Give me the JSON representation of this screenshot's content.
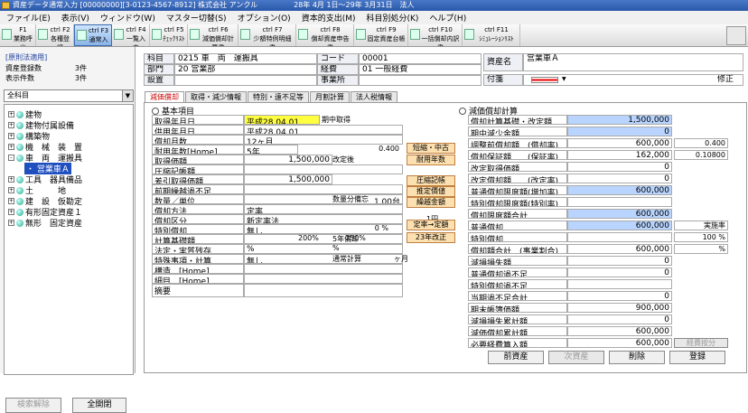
{
  "window": {
    "title": "資産データ通常入力 [00000000][3-0123-4567-8912] 株式会社 アンクル　　　　　28年 4月 1日～29年 3月31日　法人"
  },
  "menu": [
    "ファイル(E)",
    "表示(V)",
    "ウィンドウ(W)",
    "マスター切替(S)",
    "オプション(O)",
    "資本的支出(M)",
    "科目別処分(K)",
    "ヘルプ(H)"
  ],
  "toolbar": [
    {
      "key": "F1",
      "label": "業務呼出"
    },
    {
      "key": "ctrl F2",
      "label": "各種登録"
    },
    {
      "key": "ctrl F3",
      "label": "通常入力"
    },
    {
      "key": "ctrl F4",
      "label": "一覧入力"
    },
    {
      "key": "ctrl F5",
      "label": "ﾁｪｯｸﾘｽﾄ"
    },
    {
      "key": "ctrl F6",
      "label": "減価償却計算書"
    },
    {
      "key": "ctrl F7",
      "label": "少額特例明細書"
    },
    {
      "key": "ctrl F8",
      "label": "償却資産申告書"
    },
    {
      "key": "ctrl F9",
      "label": "固定資産台帳"
    },
    {
      "key": "ctrl F10",
      "label": "一括償却内訳書"
    },
    {
      "key": "ctrl F11",
      "label": "ｼﾐｭﾚｰｼｮﾝﾘｽﾄ"
    }
  ],
  "left": {
    "mode": "[原則法適用]",
    "stats": [
      {
        "label": "資産登録数",
        "value": "3件"
      },
      {
        "label": "表示件数",
        "value": "3件"
      }
    ],
    "filter": "全科目",
    "tree": [
      {
        "label": "建物",
        "exp": "+"
      },
      {
        "label": "建物付属設備",
        "exp": "+"
      },
      {
        "label": "構築物",
        "exp": "+"
      },
      {
        "label": "機　械　装　置",
        "exp": "+"
      },
      {
        "label": "車　両　運搬具",
        "exp": "-"
      },
      {
        "label": "・ 営業車Ａ",
        "exp": ""
      },
      {
        "label": "工具　器具備品",
        "exp": "+"
      },
      {
        "label": "土　　　地",
        "exp": "+"
      },
      {
        "label": "建　設　仮勘定",
        "exp": "+"
      },
      {
        "label": "有形固定資産１",
        "exp": "+"
      },
      {
        "label": "無形　固定資産",
        "exp": "+"
      }
    ],
    "btn_search_clear": "検索解除",
    "btn_expand_all": "全開閉"
  },
  "header": {
    "kamoku_lbl": "科目",
    "kamoku_val": "0215 車　両　運搬具",
    "code_lbl": "コード",
    "code_val": "00001",
    "shisanmei_lbl": "資産名",
    "shisanmei_val": "営業車Ａ",
    "bumon_lbl": "部門",
    "bumon_val": "20 営業部",
    "keihi_lbl": "経費",
    "keihi_val": "01 一般経費",
    "basho_lbl": "設置",
    "jigyosho_lbl": "事業所",
    "fusen_lbl": "付箋",
    "fusen_val": "修正"
  },
  "tabs": [
    "減価償却",
    "取得・減少情報",
    "特別・遠不足等",
    "月割計算",
    "法人税情報"
  ],
  "basic": {
    "title": "基本項目",
    "rows": [
      {
        "label": "取得年月日",
        "value": "平成28.04.01",
        "extra": "期中取得"
      },
      {
        "label": "供用年月日",
        "value": "平成28.04.01",
        "extra": ""
      },
      {
        "label": "償却月数",
        "value": "12ヶ月",
        "extra": ""
      },
      {
        "label": "耐用年数[Home]",
        "value": "5年",
        "extra": "0.400"
      },
      {
        "label": "取得価額",
        "value": "1,500,000",
        "extra": "改定後"
      },
      {
        "label": "圧縮記帳額",
        "value": "",
        "extra": ""
      },
      {
        "label": "差引取得価額",
        "value": "1,500,000",
        "extra": ""
      },
      {
        "label": "前期繰越過不足",
        "value": "",
        "extra": ""
      },
      {
        "label": "数量／単位",
        "value": "1.00台",
        "extra": "数量分備忘"
      },
      {
        "label": "償却方法",
        "value": "定率",
        "extra": ""
      },
      {
        "label": "償却区分",
        "value": "新定率法",
        "extra": ""
      },
      {
        "label": "特別償却",
        "value": "無し",
        "extra": "0 %"
      },
      {
        "label": "計算基礎額",
        "value": "",
        "extra": "5年償却"
      },
      {
        "label": "法定・実質残存",
        "value": "%",
        "extra": "%"
      },
      {
        "label": "特殊事項・計算",
        "value": "無し",
        "extra": "通常計算"
      },
      {
        "label": "構造　[Home]",
        "value": "",
        "extra": ""
      },
      {
        "label": "細目　[Home]",
        "value": "",
        "extra": ""
      },
      {
        "label": "摘要",
        "value": "",
        "extra": ""
      }
    ],
    "radio_200": "200%",
    "radio_250": "250%",
    "tsuki_unit": "ヶ月",
    "unit_yen": "1円",
    "buttons": [
      "短縮・中古",
      "耐用年数",
      "圧縮記帳",
      "推定價値",
      "繰越金額",
      "定率→定額",
      "23年改正"
    ]
  },
  "calc": {
    "title": "減価償却計算",
    "rows": [
      {
        "label": "償却計算基礎・改定額",
        "value": "1,500,000",
        "extra": "",
        "blue": true
      },
      {
        "label": "期中減少金額",
        "value": "0",
        "extra": "",
        "blue": true
      },
      {
        "label": "調整前償却額　(償却率)",
        "value": "600,000",
        "extra": "0.400",
        "blue": false
      },
      {
        "label": "償却保証額　　(保証率)",
        "value": "162,000",
        "extra": "0.10800",
        "blue": false
      },
      {
        "label": "改定取得価額",
        "value": "0",
        "extra": "",
        "blue": false
      },
      {
        "label": "改定償却額　　(改定率)",
        "value": "0",
        "extra": "",
        "blue": false
      },
      {
        "label": "普通償却限度額(増加率)",
        "value": "600,000",
        "extra": "",
        "blue": true
      },
      {
        "label": "特別償却限度額(特別率)",
        "value": "",
        "extra": "",
        "blue": false
      },
      {
        "label": "償却限度額合計",
        "value": "600,000",
        "extra": "",
        "blue": true
      },
      {
        "label": "普通償却",
        "value": "600,000",
        "extra": "実施率",
        "blue": true
      },
      {
        "label": "特別償却",
        "value": "",
        "extra": "100 %",
        "blue": false
      },
      {
        "label": "償却額合計　(事業割合)",
        "value": "600,000",
        "extra": "%",
        "blue": false
      },
      {
        "label": "減損損失額",
        "value": "0",
        "extra": "",
        "blue": false
      },
      {
        "label": "普通償却過不足",
        "value": "0",
        "extra": "",
        "blue": false
      },
      {
        "label": "特別償却過不足",
        "value": "",
        "extra": "",
        "blue": false
      },
      {
        "label": "当期過不足合計",
        "value": "0",
        "extra": "",
        "blue": false
      },
      {
        "label": "期末帳簿価額",
        "value": "900,000",
        "extra": "",
        "blue": false
      },
      {
        "label": "減損損失累計額",
        "value": "0",
        "extra": "",
        "blue": false
      },
      {
        "label": "減価償却累計額",
        "value": "600,000",
        "extra": "",
        "blue": false
      },
      {
        "label": "必要経費算入額",
        "value": "600,000",
        "extra": "経費按分",
        "blue": false
      }
    ]
  },
  "bottom": {
    "prev": "前資産",
    "next": "次資産",
    "del": "削除",
    "save": "登録"
  }
}
